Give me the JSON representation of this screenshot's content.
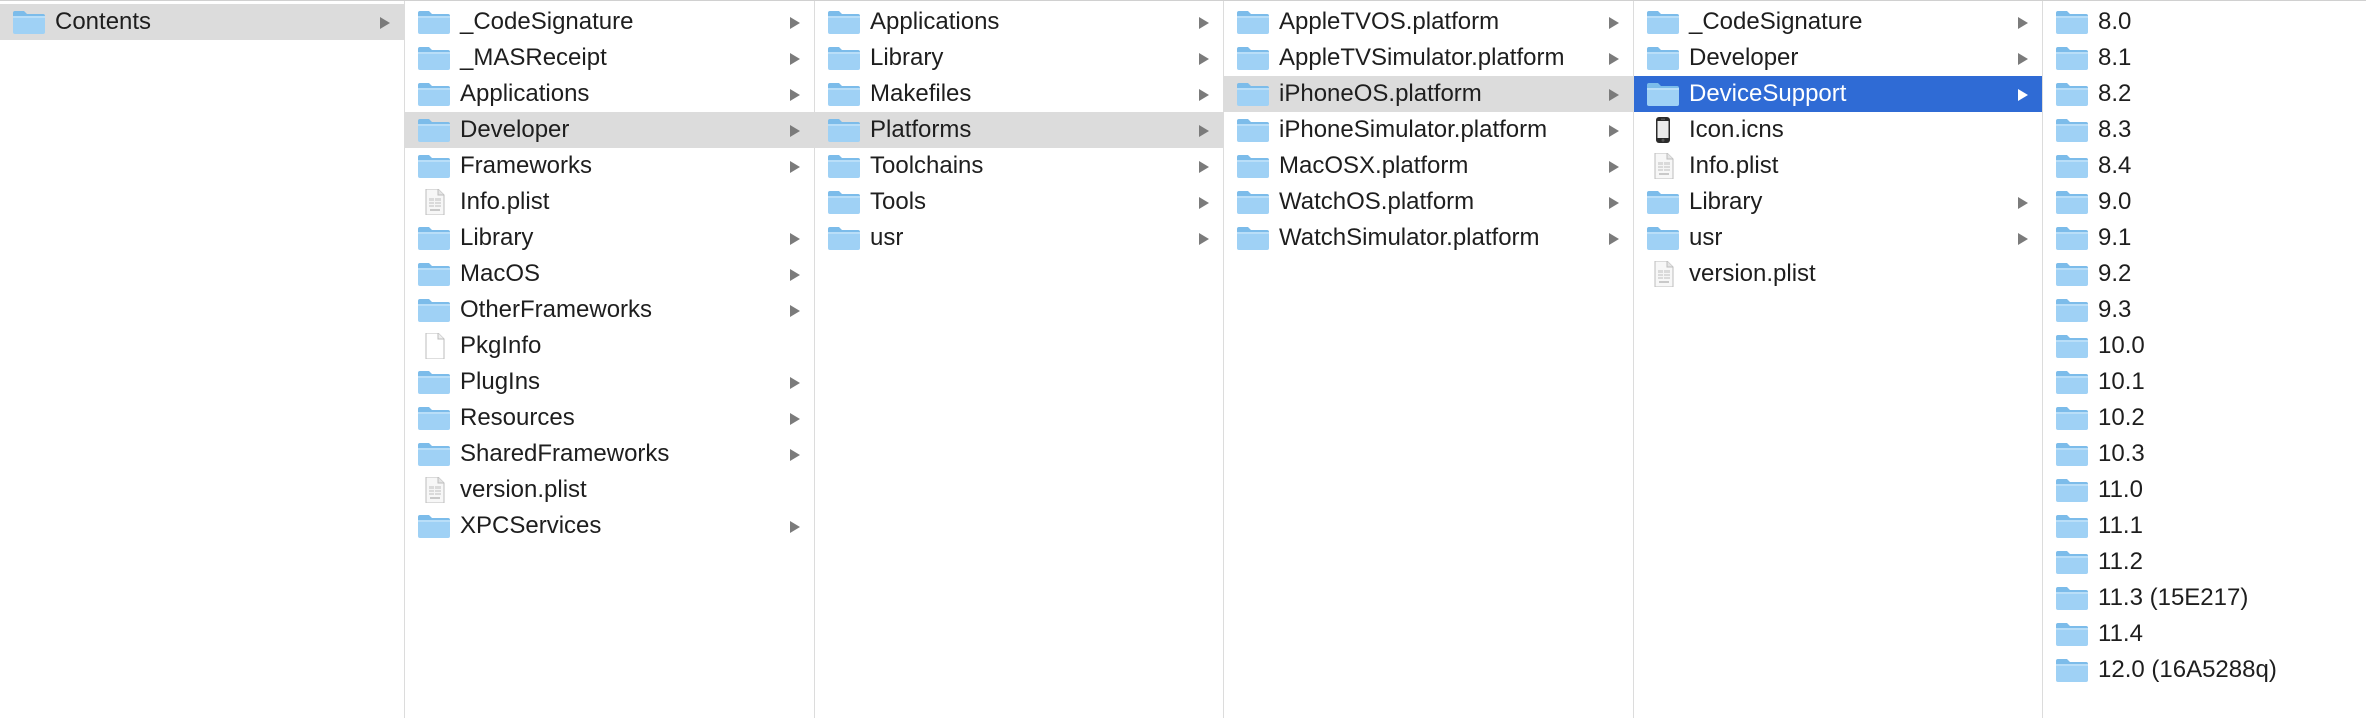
{
  "columns": [
    {
      "items": [
        {
          "name": "Contents",
          "kind": "folder",
          "has_children": true,
          "state": "path"
        }
      ]
    },
    {
      "items": [
        {
          "name": "_CodeSignature",
          "kind": "folder",
          "has_children": true
        },
        {
          "name": "_MASReceipt",
          "kind": "folder",
          "has_children": true
        },
        {
          "name": "Applications",
          "kind": "folder",
          "has_children": true
        },
        {
          "name": "Developer",
          "kind": "folder",
          "has_children": true,
          "state": "path"
        },
        {
          "name": "Frameworks",
          "kind": "folder",
          "has_children": true
        },
        {
          "name": "Info.plist",
          "kind": "plist",
          "has_children": false
        },
        {
          "name": "Library",
          "kind": "folder",
          "has_children": true
        },
        {
          "name": "MacOS",
          "kind": "folder",
          "has_children": true
        },
        {
          "name": "OtherFrameworks",
          "kind": "folder",
          "has_children": true
        },
        {
          "name": "PkgInfo",
          "kind": "document",
          "has_children": false
        },
        {
          "name": "PlugIns",
          "kind": "folder",
          "has_children": true
        },
        {
          "name": "Resources",
          "kind": "folder",
          "has_children": true
        },
        {
          "name": "SharedFrameworks",
          "kind": "folder",
          "has_children": true
        },
        {
          "name": "version.plist",
          "kind": "plist",
          "has_children": false
        },
        {
          "name": "XPCServices",
          "kind": "folder",
          "has_children": true
        }
      ]
    },
    {
      "items": [
        {
          "name": "Applications",
          "kind": "folder",
          "has_children": true
        },
        {
          "name": "Library",
          "kind": "folder",
          "has_children": true
        },
        {
          "name": "Makefiles",
          "kind": "folder",
          "has_children": true
        },
        {
          "name": "Platforms",
          "kind": "folder",
          "has_children": true,
          "state": "path"
        },
        {
          "name": "Toolchains",
          "kind": "folder",
          "has_children": true
        },
        {
          "name": "Tools",
          "kind": "folder",
          "has_children": true
        },
        {
          "name": "usr",
          "kind": "folder",
          "has_children": true
        }
      ]
    },
    {
      "items": [
        {
          "name": "AppleTVOS.platform",
          "kind": "folder",
          "has_children": true
        },
        {
          "name": "AppleTVSimulator.platform",
          "kind": "folder",
          "has_children": true
        },
        {
          "name": "iPhoneOS.platform",
          "kind": "folder",
          "has_children": true,
          "state": "path"
        },
        {
          "name": "iPhoneSimulator.platform",
          "kind": "folder",
          "has_children": true
        },
        {
          "name": "MacOSX.platform",
          "kind": "folder",
          "has_children": true
        },
        {
          "name": "WatchOS.platform",
          "kind": "folder",
          "has_children": true
        },
        {
          "name": "WatchSimulator.platform",
          "kind": "folder",
          "has_children": true
        }
      ]
    },
    {
      "items": [
        {
          "name": "_CodeSignature",
          "kind": "folder",
          "has_children": true
        },
        {
          "name": "Developer",
          "kind": "folder",
          "has_children": true
        },
        {
          "name": "DeviceSupport",
          "kind": "folder",
          "has_children": true,
          "state": "selected"
        },
        {
          "name": "Icon.icns",
          "kind": "iphone",
          "has_children": false
        },
        {
          "name": "Info.plist",
          "kind": "plist",
          "has_children": false
        },
        {
          "name": "Library",
          "kind": "folder",
          "has_children": true
        },
        {
          "name": "usr",
          "kind": "folder",
          "has_children": true
        },
        {
          "name": "version.plist",
          "kind": "plist",
          "has_children": false
        }
      ]
    },
    {
      "items": [
        {
          "name": "8.0",
          "kind": "folder",
          "has_children": false
        },
        {
          "name": "8.1",
          "kind": "folder",
          "has_children": false
        },
        {
          "name": "8.2",
          "kind": "folder",
          "has_children": false
        },
        {
          "name": "8.3",
          "kind": "folder",
          "has_children": false
        },
        {
          "name": "8.4",
          "kind": "folder",
          "has_children": false
        },
        {
          "name": "9.0",
          "kind": "folder",
          "has_children": false
        },
        {
          "name": "9.1",
          "kind": "folder",
          "has_children": false
        },
        {
          "name": "9.2",
          "kind": "folder",
          "has_children": false
        },
        {
          "name": "9.3",
          "kind": "folder",
          "has_children": false
        },
        {
          "name": "10.0",
          "kind": "folder",
          "has_children": false
        },
        {
          "name": "10.1",
          "kind": "folder",
          "has_children": false
        },
        {
          "name": "10.2",
          "kind": "folder",
          "has_children": false
        },
        {
          "name": "10.3",
          "kind": "folder",
          "has_children": false
        },
        {
          "name": "11.0",
          "kind": "folder",
          "has_children": false
        },
        {
          "name": "11.1",
          "kind": "folder",
          "has_children": false
        },
        {
          "name": "11.2",
          "kind": "folder",
          "has_children": false
        },
        {
          "name": "11.3 (15E217)",
          "kind": "folder",
          "has_children": false
        },
        {
          "name": "11.4",
          "kind": "folder",
          "has_children": false
        },
        {
          "name": "12.0 (16A5288q)",
          "kind": "folder",
          "has_children": false
        }
      ]
    }
  ],
  "colors": {
    "selection": "#2f6bd5",
    "path_highlight": "#dcdcdc",
    "folder_body": "#9fd1f5",
    "folder_tab": "#7cbcea"
  }
}
